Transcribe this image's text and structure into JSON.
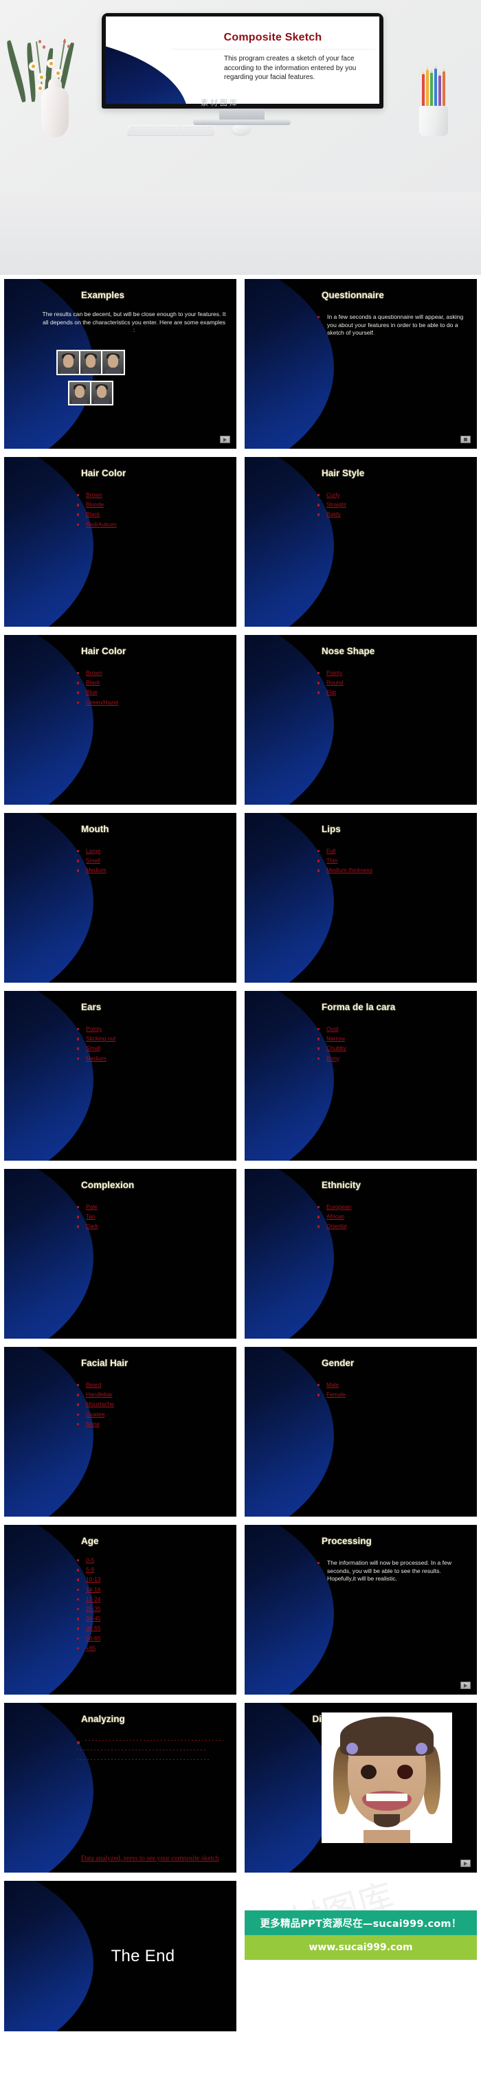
{
  "hero": {
    "title_slide": {
      "title": "Composite Sketch",
      "body": "This program creates a sketch of your face according to the information entered by you regarding your facial features.",
      "watermark": "素材图库",
      "desk_watermark": "素材图库"
    }
  },
  "slides": [
    {
      "name": "examples",
      "title": "Examples",
      "title_align": "left",
      "kind": "paragraph-centered",
      "paragraph": "The results can be decent, but will be close enough to your features. It all depends on the characteristics you enter.  Here are some examples :",
      "photos_count": 5,
      "nav": "play"
    },
    {
      "name": "questionnaire",
      "title": "Questionnaire",
      "title_align": "left",
      "kind": "paragraph-bullet",
      "paragraph": "In a few seconds a questionnaire will appear, asking you about your features in order to be able to do a sketch of yourself.",
      "nav": "square"
    },
    {
      "name": "hair-color-1",
      "title": "Hair Color",
      "title_align": "left",
      "kind": "links",
      "items": [
        "Brown",
        "Blonde",
        "Black",
        "Red/Auburn"
      ]
    },
    {
      "name": "hair-style",
      "title": "Hair Style",
      "title_align": "left",
      "kind": "links",
      "items": [
        "Curly",
        "Straight",
        "Baldy"
      ]
    },
    {
      "name": "hair-color-2",
      "title": "Hair Color",
      "title_align": "left",
      "kind": "links",
      "items": [
        "Brown",
        "Black",
        "Blue",
        "Green/Hazel"
      ]
    },
    {
      "name": "nose-shape",
      "title": "Nose Shape",
      "title_align": "left",
      "kind": "links",
      "items": [
        "Pointy",
        "Round",
        "Flat"
      ]
    },
    {
      "name": "mouth",
      "title": "Mouth",
      "title_align": "left",
      "kind": "links",
      "items": [
        "Large",
        "Small",
        "Medium"
      ]
    },
    {
      "name": "lips",
      "title": "Lips",
      "title_align": "left",
      "kind": "links",
      "items": [
        "Full",
        "Thin",
        "Medium thickness"
      ]
    },
    {
      "name": "ears",
      "title": "Ears",
      "title_align": "left",
      "kind": "links",
      "items": [
        "Pointy",
        "Sticking out",
        "Small",
        "Medium"
      ]
    },
    {
      "name": "face-shape",
      "title": "Forma de la cara",
      "title_align": "left",
      "kind": "links",
      "items": [
        "Oval",
        "Narrow",
        "Chubby",
        "Bony"
      ]
    },
    {
      "name": "complexion",
      "title": "Complexion",
      "title_align": "left",
      "kind": "links",
      "items": [
        "Pale",
        "Tan",
        "Dark"
      ]
    },
    {
      "name": "ethnicity",
      "title": "Ethnicity",
      "title_align": "left",
      "kind": "links",
      "items": [
        "European",
        "African",
        "Oriental"
      ]
    },
    {
      "name": "facial-hair",
      "title": "Facial Hair",
      "title_align": "left",
      "kind": "links",
      "items": [
        "Beard",
        "Handlebar",
        "Moustache",
        "Goatee",
        "None"
      ]
    },
    {
      "name": "gender",
      "title": "Gender",
      "title_align": "left",
      "kind": "links",
      "items": [
        "Male",
        "Female"
      ]
    },
    {
      "name": "age",
      "title": "Age",
      "title_align": "left",
      "kind": "links",
      "items": [
        "0-5",
        "5-9",
        "10-13",
        "14-16",
        "17-24",
        "25-35",
        "36-45",
        "46-55",
        "56-65",
        "+65"
      ]
    },
    {
      "name": "processing",
      "title": "Processing",
      "title_align": "left",
      "kind": "paragraph-bullet",
      "paragraph": "The information will now be processed. In a few seconds, you will be able to see the results. Hopefully,it will be realistic.",
      "nav": "play"
    },
    {
      "name": "analyzing",
      "title": "Analyzing",
      "title_align": "left",
      "kind": "dots",
      "link_text": "Data analyzed, press to see your composite sketch"
    },
    {
      "name": "did-you-come-out-ok",
      "title": "Did you come out ok?",
      "title_align": "center",
      "kind": "photo",
      "nav": "play"
    },
    {
      "name": "the-end",
      "title": "The End",
      "kind": "end"
    },
    {
      "name": "promo-banner",
      "kind": "banner",
      "banner_top": "更多精品PPT资源尽在—sucai999.com！",
      "banner_bottom": "www.sucai999.com",
      "watermark": "素材图库"
    }
  ],
  "colors": {
    "slide_bg": "#010101",
    "wave_blue": "#123bad",
    "title_cream": "#fbf7d8",
    "link_red": "#a8101a",
    "body_text": "#e9e9e4",
    "banner_teal": "#1aa881",
    "banner_green": "#97c93d",
    "hero_title_red": "#8b0c13"
  }
}
